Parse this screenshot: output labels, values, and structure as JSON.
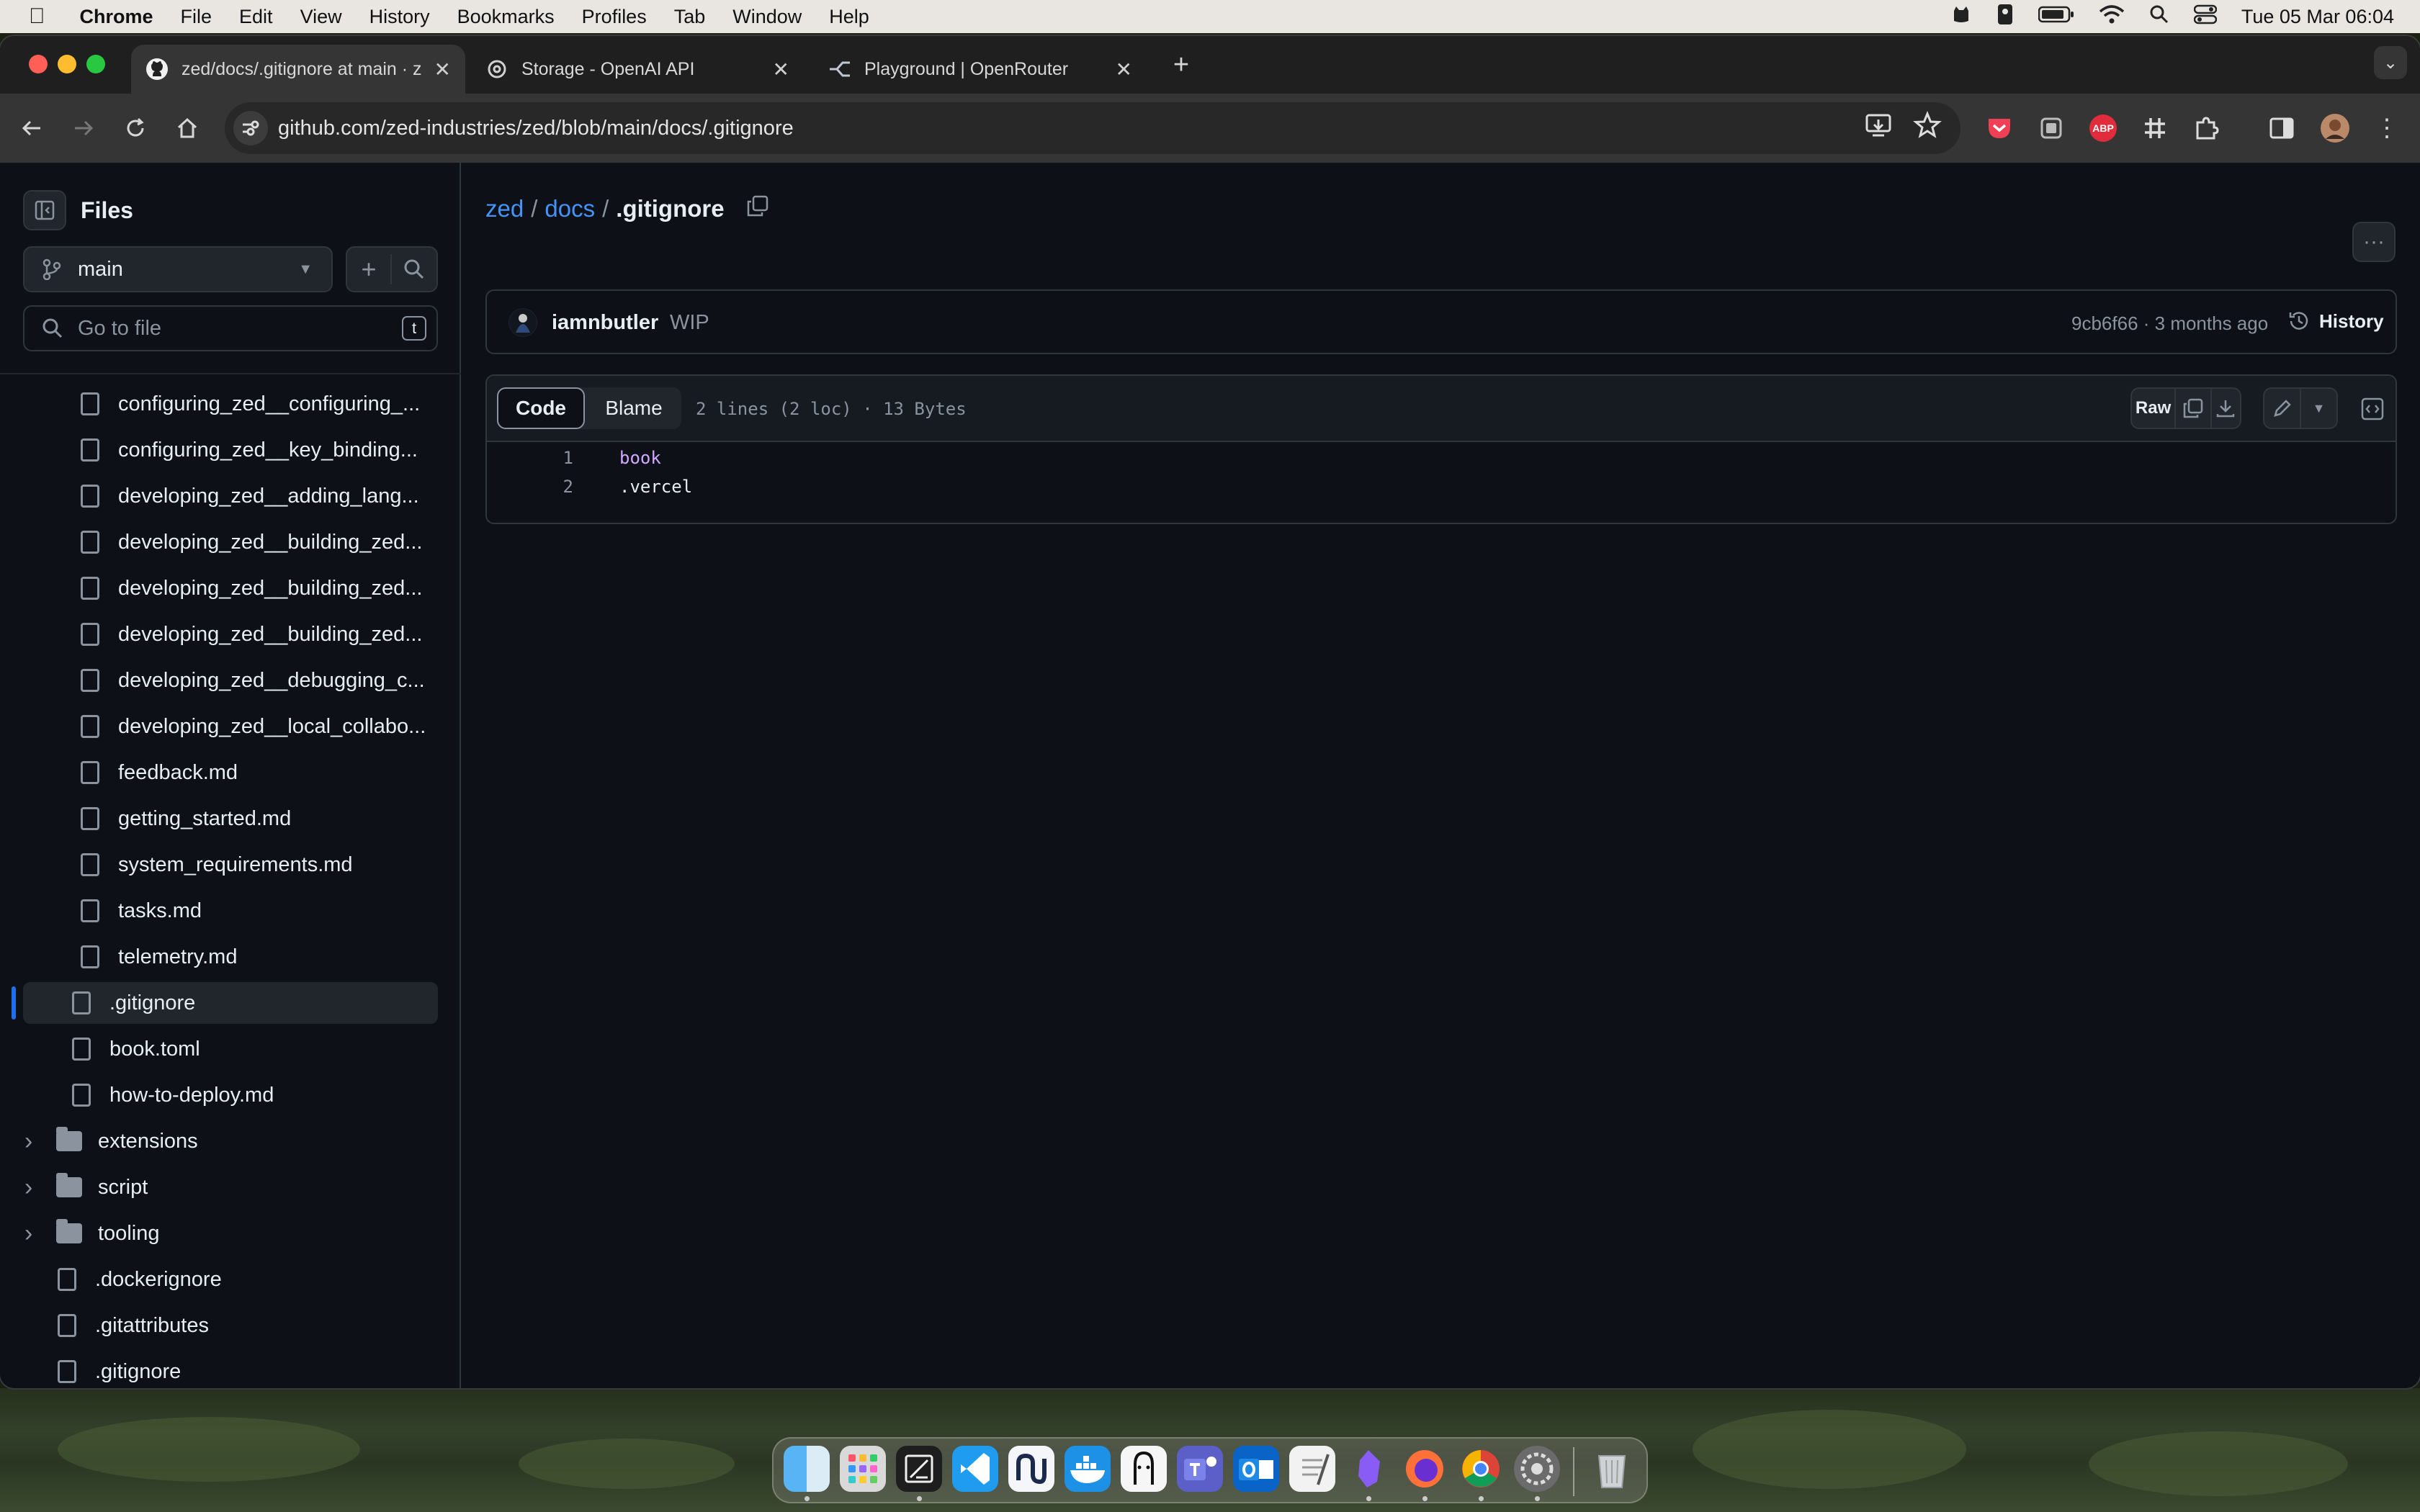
{
  "menubar": {
    "apple": "",
    "app": "Chrome",
    "items": [
      "File",
      "Edit",
      "View",
      "History",
      "Bookmarks",
      "Profiles",
      "Tab",
      "Window",
      "Help"
    ],
    "clock": "Tue 05 Mar  06:04"
  },
  "tabs": [
    {
      "title": "zed/docs/.gitignore at main · z",
      "active": true
    },
    {
      "title": "Storage - OpenAI API",
      "active": false
    },
    {
      "title": "Playground | OpenRouter",
      "active": false
    }
  ],
  "toolbar": {
    "url": "github.com/zed-industries/zed/blob/main/docs/.gitignore",
    "extension_badge": "ABP"
  },
  "sidebar": {
    "title": "Files",
    "branch": "main",
    "search_placeholder": "Go to file",
    "search_shortcut": "t",
    "tree": [
      {
        "label": "configuring_zed__configuring_...",
        "kind": "file",
        "indent": 2
      },
      {
        "label": "configuring_zed__key_binding...",
        "kind": "file",
        "indent": 2
      },
      {
        "label": "developing_zed__adding_lang...",
        "kind": "file",
        "indent": 2
      },
      {
        "label": "developing_zed__building_zed...",
        "kind": "file",
        "indent": 2
      },
      {
        "label": "developing_zed__building_zed...",
        "kind": "file",
        "indent": 2
      },
      {
        "label": "developing_zed__building_zed...",
        "kind": "file",
        "indent": 2
      },
      {
        "label": "developing_zed__debugging_c...",
        "kind": "file",
        "indent": 2
      },
      {
        "label": "developing_zed__local_collabo...",
        "kind": "file",
        "indent": 2
      },
      {
        "label": "feedback.md",
        "kind": "file",
        "indent": 2
      },
      {
        "label": "getting_started.md",
        "kind": "file",
        "indent": 2
      },
      {
        "label": "system_requirements.md",
        "kind": "file",
        "indent": 2
      },
      {
        "label": "tasks.md",
        "kind": "file",
        "indent": 2
      },
      {
        "label": "telemetry.md",
        "kind": "file",
        "indent": 2
      },
      {
        "label": ".gitignore",
        "kind": "file",
        "indent": 1,
        "selected": true
      },
      {
        "label": "book.toml",
        "kind": "file",
        "indent": 1
      },
      {
        "label": "how-to-deploy.md",
        "kind": "file",
        "indent": 1
      },
      {
        "label": "extensions",
        "kind": "folder",
        "indent": 0
      },
      {
        "label": "script",
        "kind": "folder",
        "indent": 0
      },
      {
        "label": "tooling",
        "kind": "folder",
        "indent": 0
      },
      {
        "label": ".dockerignore",
        "kind": "file",
        "indent": 0
      },
      {
        "label": ".gitattributes",
        "kind": "file",
        "indent": 0
      },
      {
        "label": ".gitignore",
        "kind": "file",
        "indent": 0
      }
    ]
  },
  "breadcrumb": {
    "repo": "zed",
    "folder": "docs",
    "file": ".gitignore",
    "sep": "/"
  },
  "commit": {
    "author": "iamnbutler",
    "message": "WIP",
    "hash_age": "9cb6f66 · 3 months ago",
    "history_label": "History"
  },
  "file_view": {
    "code_tab": "Code",
    "blame_tab": "Blame",
    "meta": "2 lines (2 loc) · 13 Bytes",
    "raw_label": "Raw",
    "lines": [
      {
        "num": "1",
        "text": "book"
      },
      {
        "num": "2",
        "text": ".vercel"
      }
    ]
  },
  "colors": {
    "accent_link": "#4493f8",
    "selected_marker": "#1f6feb",
    "code_keyword": "#d2a8ff"
  }
}
